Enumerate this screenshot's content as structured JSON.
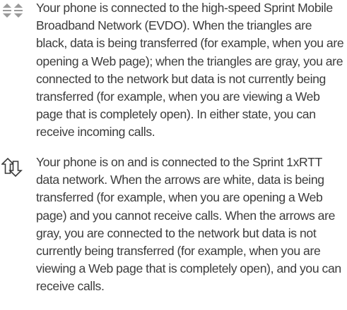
{
  "entries": [
    {
      "icon": "evdo-data-triangles-icon",
      "text": "Your phone is connected to the high-speed Sprint Mobile Broadband Network (EVDO). When the triangles are black, data is being transferred (for example, when you are opening a Web page); when the triangles are gray, you are connected to the network but data is not currently being transferred (for example, when you are viewing a Web page that is completely open). In either state, you can receive incoming calls."
    },
    {
      "icon": "1xrtt-data-arrows-icon",
      "text": "Your phone is on and is connected to the Sprint 1xRTT data network. When the arrows are white, data is being transferred (for example, when you are opening a Web page) and you cannot receive calls. When the arrows are gray, you are connected to the network but data is not currently being transferred (for example, when you are viewing a Web page that is completely open), and you can receive calls."
    }
  ],
  "colors": {
    "text": "#3c3c3c",
    "icon_gray": "#9a9a9a",
    "icon_dark": "#3a3a3a"
  }
}
